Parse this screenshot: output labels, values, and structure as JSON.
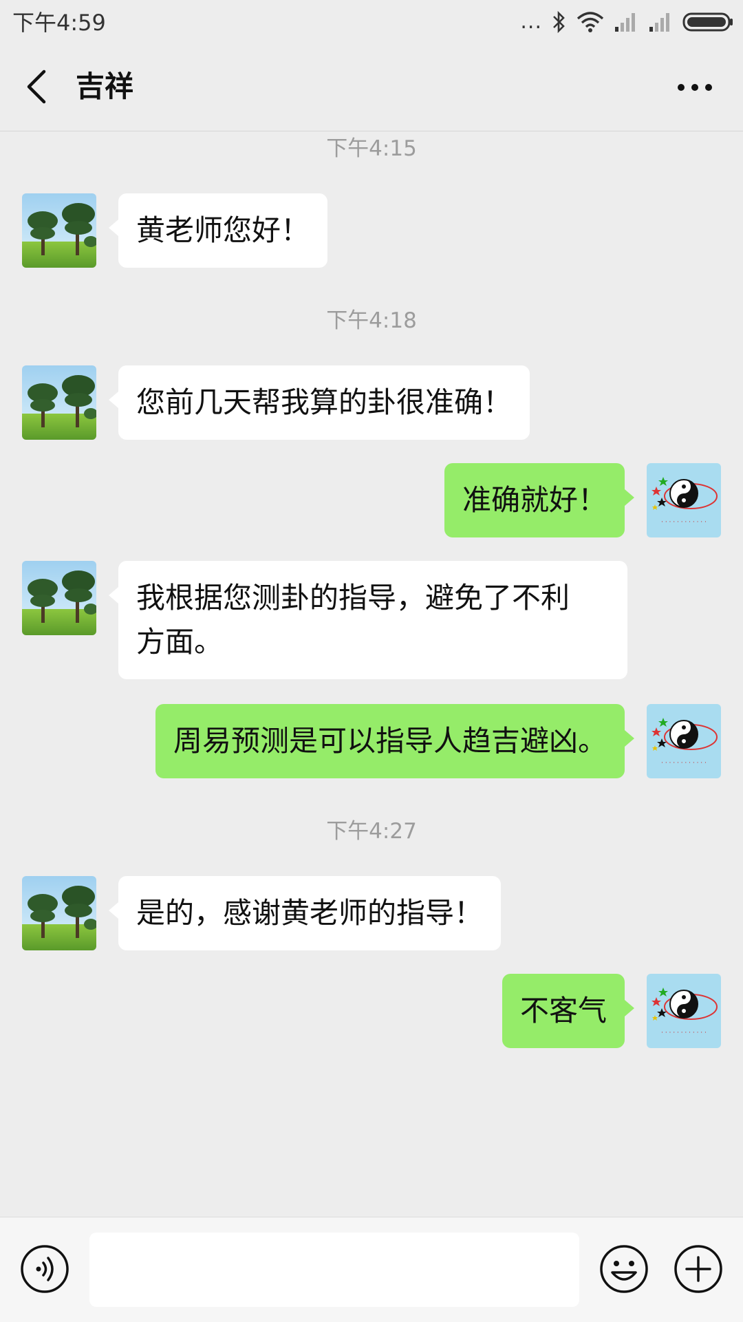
{
  "status_bar": {
    "time": "下午4:59",
    "dots": "...",
    "icons": [
      "bluetooth-icon",
      "wifi-icon",
      "signal-icon",
      "signal-icon",
      "battery-icon"
    ]
  },
  "header": {
    "title": "吉祥",
    "back_icon": "chevron-left-icon",
    "more_icon": "more-dots-icon"
  },
  "messages": [
    {
      "type": "time",
      "text": "下午4:15"
    },
    {
      "type": "msg",
      "side": "in",
      "text": "黄老师您好！"
    },
    {
      "type": "time",
      "text": "下午4:18"
    },
    {
      "type": "msg",
      "side": "in",
      "text": "您前几天帮我算的卦很准确！"
    },
    {
      "type": "msg",
      "side": "out",
      "text": "准确就好！"
    },
    {
      "type": "msg",
      "side": "in",
      "text": "我根据您测卦的指导，避免了不利\n方面。"
    },
    {
      "type": "msg",
      "side": "out",
      "text": "周易预测是可以指导人趋吉避凶。"
    },
    {
      "type": "time",
      "text": "下午4:27"
    },
    {
      "type": "msg",
      "side": "in",
      "text": "是的，感谢黄老师的指导！"
    },
    {
      "type": "msg",
      "side": "out",
      "text": "不客气"
    }
  ],
  "input_bar": {
    "voice_icon": "voice-icon",
    "input_value": "",
    "emoji_icon": "emoji-icon",
    "plus_icon": "plus-icon"
  },
  "colors": {
    "background": "#ededed",
    "incoming_bubble": "#ffffff",
    "outgoing_bubble": "#95ec69",
    "timestamp": "#9c9c9c"
  }
}
